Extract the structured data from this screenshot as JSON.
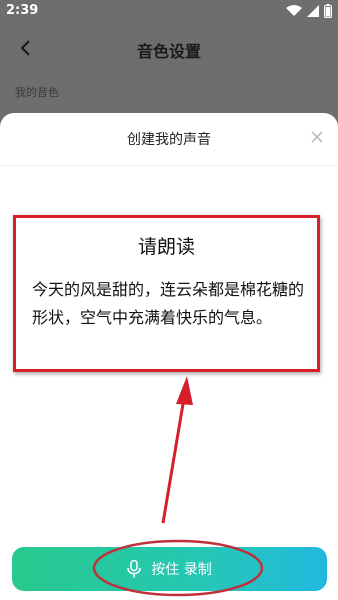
{
  "status_bar": {
    "time": "2:39"
  },
  "background": {
    "title": "音色设置",
    "section_label": "我的音色"
  },
  "sheet": {
    "title": "创建我的声音",
    "prompt": {
      "title": "请朗读",
      "text": "今天的风是甜的，连云朵都是棉花糖的形状，空气中充满着快乐的气息。"
    },
    "record_button": {
      "label": "按住 录制"
    }
  },
  "colors": {
    "highlight": "#d61f2b",
    "button_start": "#27c98c",
    "button_end": "#22b8de"
  }
}
